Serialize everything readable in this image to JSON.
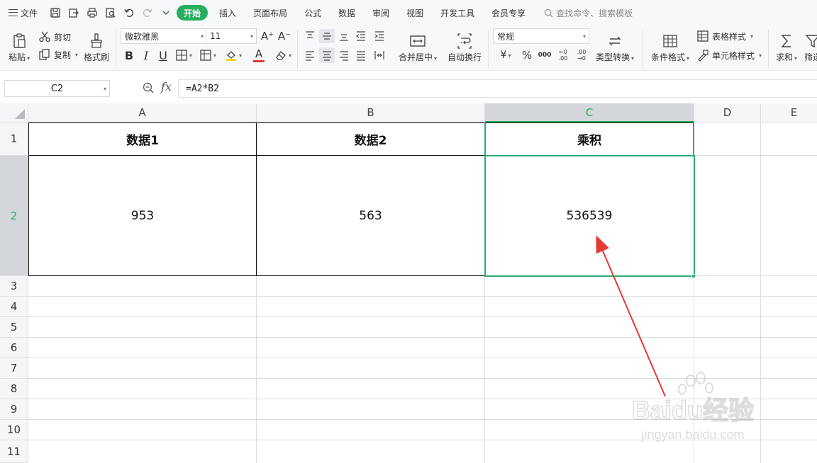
{
  "menubar": {
    "file_label": "文件",
    "tabs": [
      "开始",
      "插入",
      "页面布局",
      "公式",
      "数据",
      "审阅",
      "视图",
      "开发工具",
      "会员专享"
    ],
    "active_tab": "开始",
    "search_placeholder": "查找命令、搜索模板"
  },
  "ribbon": {
    "paste": "粘贴",
    "cut": "剪切",
    "copy": "复制",
    "format_painter": "格式刷",
    "font_name": "微软雅黑",
    "font_size": "11",
    "grow_font": "A⁺",
    "shrink_font": "A⁻",
    "bold": "B",
    "italic": "I",
    "underline": "U",
    "font_color_letter": "A",
    "merge_center": "合并居中",
    "wrap_text": "自动换行",
    "number_format": "常规",
    "currency": "¥",
    "percent": "%",
    "thousands": "000",
    "inc_decimal": "←0 .00",
    "dec_decimal": ".00 →0",
    "type_convert": "类型转换",
    "conditional_format": "条件格式",
    "table_style": "表格样式",
    "cell_style": "单元格样式",
    "sum": "求和",
    "filter": "筛选"
  },
  "formula_bar": {
    "name_box": "C2",
    "fx": "fx",
    "formula": "=A2*B2"
  },
  "grid": {
    "columns": [
      "A",
      "B",
      "C",
      "D",
      "E"
    ],
    "selected_column": "C",
    "rows": [
      "1",
      "2",
      "3",
      "4",
      "5",
      "6",
      "7",
      "8",
      "9",
      "10",
      "11"
    ],
    "selected_row": "2",
    "cells": {
      "A1": "数据1",
      "B1": "数据2",
      "C1": "乘积",
      "A2": "953",
      "B2": "563",
      "C2": "536539"
    }
  },
  "annotation": {
    "arrow_color": "#e53935"
  },
  "watermark": {
    "brand": "Baidu经验",
    "url": "jingyan.baidu.com"
  },
  "colors": {
    "accent": "#27ae60",
    "selection": "#2eaa74"
  }
}
